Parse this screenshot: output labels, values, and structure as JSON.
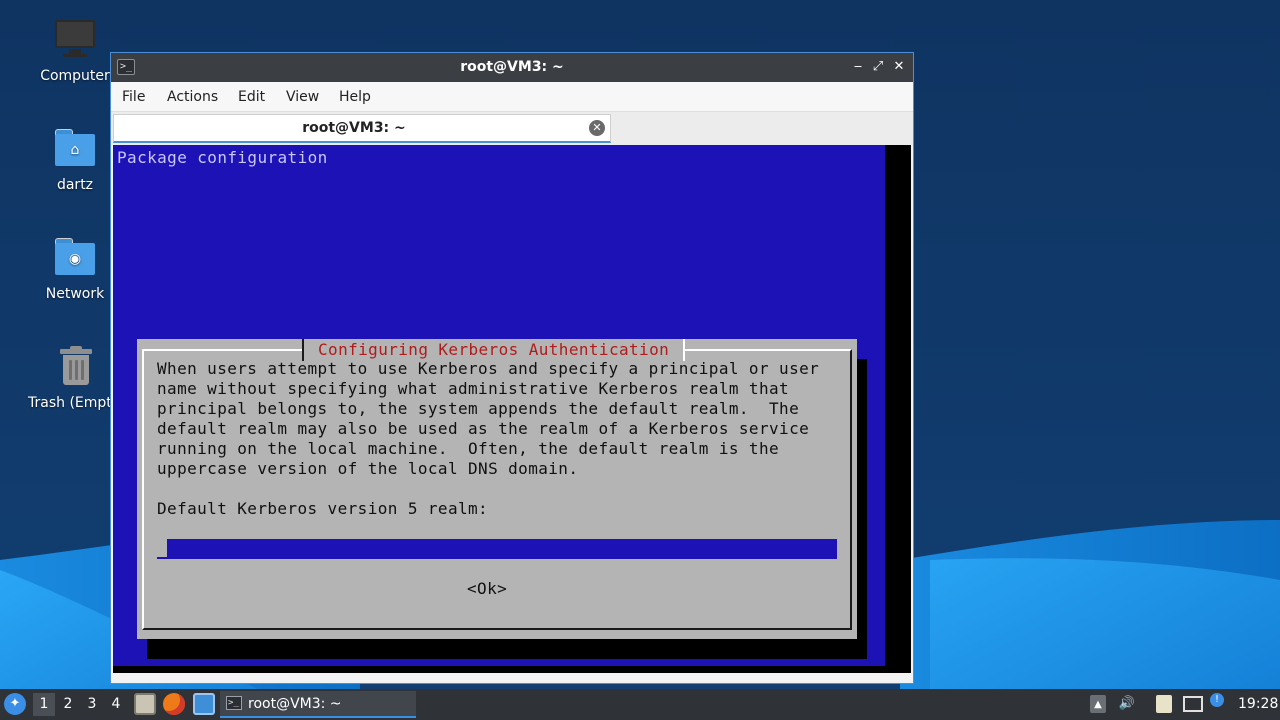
{
  "desktop": {
    "icons": [
      {
        "label": "Computer",
        "icon": "computer-icon"
      },
      {
        "label": "dartz",
        "icon": "home-folder-icon"
      },
      {
        "label": "Network",
        "icon": "network-folder-icon"
      },
      {
        "label": "Trash (Empty)",
        "icon": "trash-icon"
      }
    ]
  },
  "window": {
    "title": "root@VM3: ~",
    "menu": [
      "File",
      "Actions",
      "Edit",
      "View",
      "Help"
    ],
    "tab_title": "root@VM3: ~",
    "controls": {
      "minimize": "‒",
      "maximize": "⤢",
      "close": "✕"
    }
  },
  "terminal": {
    "header": "Package configuration",
    "dialog": {
      "title": "Configuring Kerberos Authentication",
      "body": "When users attempt to use Kerberos and specify a principal or user\nname without specifying what administrative Kerberos realm that\nprincipal belongs to, the system appends the default realm.  The\ndefault realm may also be used as the realm of a Kerberos service\nrunning on the local machine.  Often, the default realm is the\nuppercase version of the local DNS domain.",
      "prompt": "Default Kerberos version 5 realm:",
      "input_value": "",
      "ok_button": "<Ok>"
    },
    "colors": {
      "background": "#1d12b5",
      "dialog": "#b4b4b4",
      "dialog_title": "#b11b1b"
    }
  },
  "taskbar": {
    "workspaces": [
      "1",
      "2",
      "3",
      "4"
    ],
    "active_workspace": "1",
    "launchers": [
      "file-manager-icon",
      "firefox-icon",
      "show-desktop-icon"
    ],
    "task_label": "root@VM3: ~",
    "tray_icons": [
      "network-upload-icon",
      "volume-icon",
      "clipboard-icon",
      "network-icon",
      "notification-icon"
    ],
    "clock": "19:28"
  }
}
